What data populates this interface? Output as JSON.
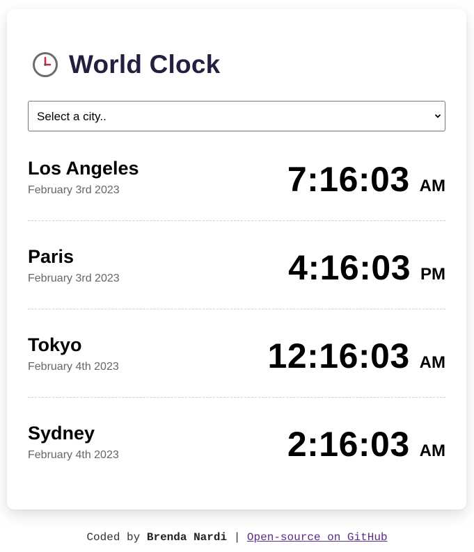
{
  "header": {
    "title": "World Clock",
    "icon": "clock-icon"
  },
  "city_select": {
    "selected": "Select a city..",
    "options": [
      "Select a city.."
    ]
  },
  "cities": [
    {
      "name": "Los Angeles",
      "date": "February 3rd 2023",
      "time": "7:16:03",
      "period": "AM"
    },
    {
      "name": "Paris",
      "date": "February 3rd 2023",
      "time": "4:16:03",
      "period": "PM"
    },
    {
      "name": "Tokyo",
      "date": "February 4th 2023",
      "time": "12:16:03",
      "period": "AM"
    },
    {
      "name": "Sydney",
      "date": "February 4th 2023",
      "time": "2:16:03",
      "period": "AM"
    }
  ],
  "footer": {
    "prefix": "Coded by",
    "author": "Brenda Nardi",
    "separator": "|",
    "link_text": "Open-source on GitHub"
  },
  "colors": {
    "title": "#221f40",
    "date": "#666666",
    "link": "#5b2a86",
    "clock_hand": "#d61f4a"
  }
}
